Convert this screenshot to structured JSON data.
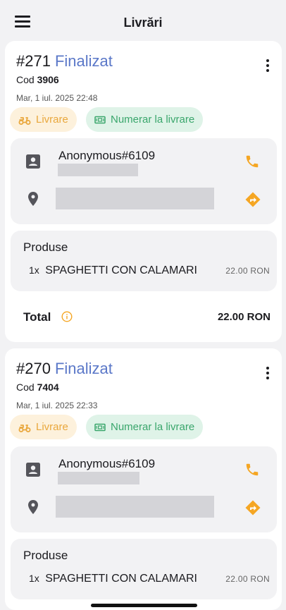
{
  "header": {
    "title": "Livrări"
  },
  "orders": [
    {
      "number": "#271",
      "status": "Finalizat",
      "code_label": "Cod",
      "code": "3906",
      "date": "Mar, 1 iul. 2025 22:48",
      "delivery_label": "Livrare",
      "payment_label": "Numerar la livrare",
      "customer_name": "Anonymous#6109",
      "products_title": "Produse",
      "items": [
        {
          "qty": "1x",
          "name": "SPAGHETTI CON CALAMARI",
          "price": "22.00 RON"
        }
      ],
      "total_label": "Total",
      "total_value": "22.00 RON"
    },
    {
      "number": "#270",
      "status": "Finalizat",
      "code_label": "Cod",
      "code": "7404",
      "date": "Mar, 1 iul. 2025 22:33",
      "delivery_label": "Livrare",
      "payment_label": "Numerar la livrare",
      "customer_name": "Anonymous#6109",
      "products_title": "Produse",
      "items": [
        {
          "qty": "1x",
          "name": "SPAGHETTI CON CALAMARI",
          "price": "22.00 RON"
        }
      ]
    }
  ],
  "colors": {
    "status": "#5b78c8",
    "delivery_chip_bg": "#fdf1dc",
    "delivery_chip_fg": "#e9a73c",
    "payment_chip_bg": "#dff3e8",
    "payment_chip_fg": "#3aa66c",
    "action_orange": "#f5a623"
  },
  "icons": [
    "menu-icon",
    "more-vert-icon",
    "scooter-icon",
    "cash-icon",
    "contact-icon",
    "phone-icon",
    "location-pin-icon",
    "directions-icon",
    "info-icon"
  ]
}
